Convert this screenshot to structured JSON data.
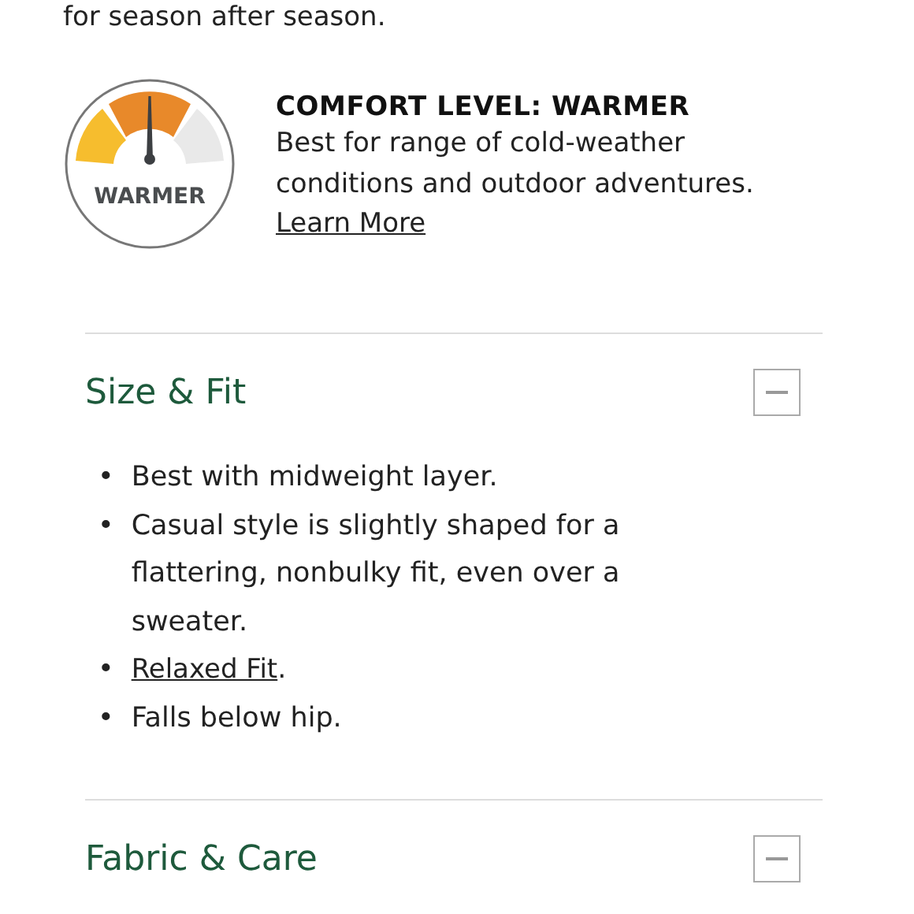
{
  "intro_tail": "for season after season.",
  "comfort": {
    "badge_label": "WARMER",
    "heading": "COMFORT LEVEL: WARMER",
    "description": "Best for range of cold-weather conditions and outdoor adventures.",
    "link": "Learn More"
  },
  "sections": [
    {
      "title": "Size & Fit",
      "expanded": true,
      "items": [
        {
          "kind": "text",
          "marker": "•",
          "text": "Best with midweight layer."
        },
        {
          "kind": "text",
          "marker": "•",
          "text": "Casual style is slightly shaped for a flattering, nonbulky fit, even over a sweater."
        },
        {
          "kind": "link",
          "marker": "•",
          "link": "Relaxed Fit",
          "after": "."
        },
        {
          "kind": "text",
          "marker": "•",
          "text": "Falls below hip."
        }
      ]
    },
    {
      "title": "Fabric & Care",
      "expanded": true
    }
  ]
}
